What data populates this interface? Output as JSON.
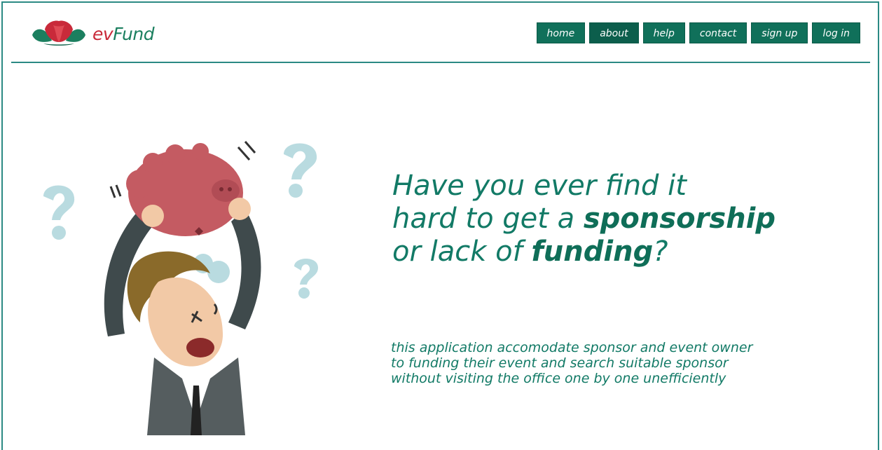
{
  "brand": {
    "name_prefix": "ev",
    "name_suffix": "Fund",
    "logo_icon": "lotus-icon",
    "colors": {
      "accent": "#10705a",
      "brand_red": "#c92a3a",
      "border": "#2b8a84"
    }
  },
  "nav": {
    "items": [
      {
        "label": "home",
        "active": false
      },
      {
        "label": "about",
        "active": true
      },
      {
        "label": "help",
        "active": false
      },
      {
        "label": "contact",
        "active": false
      },
      {
        "label": "sign up",
        "active": false
      },
      {
        "label": "log in",
        "active": false
      }
    ]
  },
  "hero": {
    "headline_line1": "Have you ever find it",
    "headline_line2_pre": "hard to get a ",
    "headline_line2_bold": "sponsorship",
    "headline_line3_pre": "or lack of ",
    "headline_line3_bold": "funding",
    "headline_line3_post": "?",
    "tagline_line1": "this application accomodate sponsor and event owner",
    "tagline_line2": "to funding their event and search suitable sponsor",
    "tagline_line3": "without visiting the office one by one unefficiently",
    "illustration": "man-breaking-piggy-bank-illustration"
  }
}
